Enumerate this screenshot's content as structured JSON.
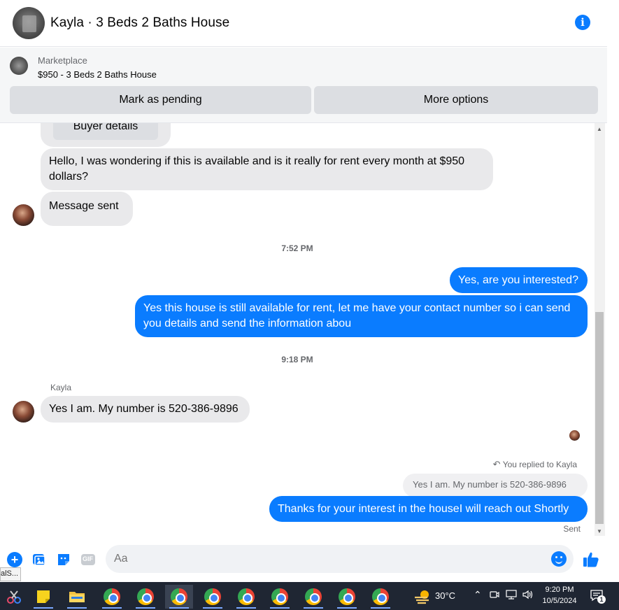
{
  "header": {
    "title": "Kayla · 3 Beds 2 Baths House",
    "info_icon": "info-icon"
  },
  "marketplace": {
    "label": "Marketplace",
    "item": "$950 - 3 Beds 2 Baths House",
    "mark_pending": "Mark as pending",
    "more_options": "More options"
  },
  "chat": {
    "buyer_details": "Buyer details",
    "msg1": "Hello, I was wondering if this is available and is it really for rent every month at $950 dollars?",
    "msg2": "Message sent",
    "time1": "7:52 PM",
    "out1": "Yes, are you interested?",
    "out2": "Yes this house is still available for rent, let me have your contact number so i can send you details and send the information abou",
    "time2": "9:18 PM",
    "sender": "Kayla",
    "msg3": "Yes I am. My number is 520-386-9896",
    "reply_note": "You replied to Kayla",
    "quoted": "Yes I am. My number is 520-386-9896",
    "out3": "Thanks for your interest in the houseI will reach out Shortly",
    "status": "Sent"
  },
  "composer": {
    "placeholder": "Aa",
    "icons": [
      "plus-icon",
      "photo-icon",
      "sticker-icon",
      "gif-icon",
      "emoji-icon",
      "like-icon"
    ],
    "gif_label": "GIF"
  },
  "tooltip": "alS...",
  "taskbar": {
    "weather": "30°C",
    "time": "9:20 PM",
    "date": "10/5/2024",
    "notification_count": "1"
  },
  "colors": {
    "accent": "#0a7cff",
    "incoming": "#e9e9eb",
    "taskbar": "#1f2633"
  }
}
